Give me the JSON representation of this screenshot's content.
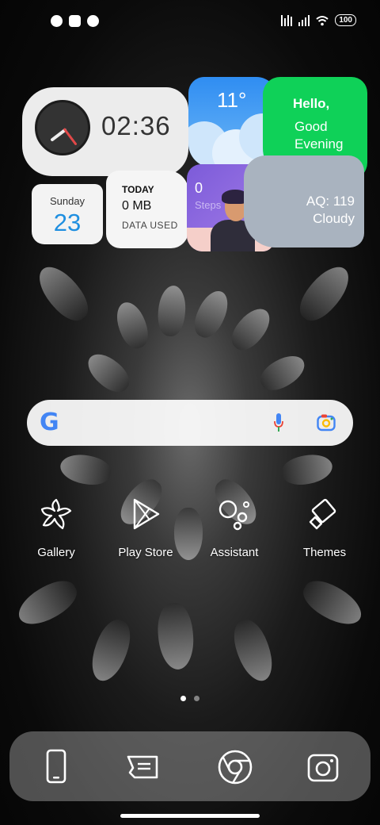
{
  "status_bar": {
    "battery": "100",
    "left_icons": [
      "notification-icon",
      "square-icon",
      "notification-icon"
    ],
    "right_icons": [
      "signal-icon",
      "signal-icon",
      "wifi-icon",
      "battery-icon"
    ]
  },
  "widgets": {
    "clock": {
      "time": "02:36"
    },
    "weather": {
      "temperature": "11°"
    },
    "greeting": {
      "line1": "Hello,",
      "line2": "Good",
      "line3": "Evening"
    },
    "date": {
      "day_name": "Sunday",
      "day_number": "23"
    },
    "data_usage": {
      "period": "TODAY",
      "amount": "0 MB",
      "label": "DATA USED"
    },
    "steps": {
      "count": "0",
      "label": "Steps"
    },
    "air_quality": {
      "aq": "AQ: 119",
      "condition": "Cloudy"
    }
  },
  "search_bar": {
    "logo": "G",
    "icons": [
      "mic-icon",
      "lens-icon"
    ]
  },
  "apps": [
    {
      "label": "Gallery",
      "icon": "gallery-icon"
    },
    {
      "label": "Play Store",
      "icon": "play-store-icon"
    },
    {
      "label": "Assistant",
      "icon": "assistant-icon"
    },
    {
      "label": "Themes",
      "icon": "themes-icon"
    }
  ],
  "page_indicator": {
    "pages": 2,
    "active": 1
  },
  "dock": [
    "phone-icon",
    "messages-icon",
    "chrome-icon",
    "camera-icon"
  ],
  "colors": {
    "clock_bg": "#ececec",
    "weather_bg": "#2f8df2",
    "greeting_bg": "#0fd158",
    "date_number": "#1f8fe0",
    "steps_bg": "#7c5bd9",
    "aq_bg": "#a9b3bf"
  }
}
